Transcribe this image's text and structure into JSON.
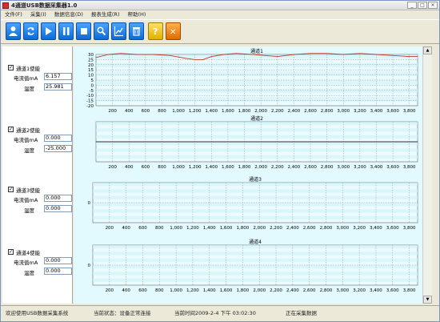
{
  "window": {
    "title": "4通道USB数据采集器1.0",
    "controls": [
      "_",
      "□",
      "×"
    ]
  },
  "menu": [
    "文件(F)",
    "采集(I)",
    "数据信息(D)",
    "报表生成(R)",
    "帮助(H)"
  ],
  "toolbar": [
    {
      "name": "user-icon",
      "color": "blue"
    },
    {
      "name": "refresh-icon",
      "color": "blue"
    },
    {
      "name": "play-icon",
      "color": "blue"
    },
    {
      "name": "pause-icon",
      "color": "blue"
    },
    {
      "name": "stop-icon",
      "color": "blue"
    },
    {
      "name": "search-icon",
      "color": "blue"
    },
    {
      "name": "chart-icon",
      "color": "blue"
    },
    {
      "name": "delete-icon",
      "color": "blue"
    },
    {
      "name": "help-icon",
      "color": "yellow",
      "glyph": "?"
    },
    {
      "name": "close-icon",
      "color": "orange",
      "glyph": "✕"
    }
  ],
  "channels": [
    {
      "enable_label": "通道1使能",
      "current_label": "电流值mA",
      "current": "6.157",
      "temp_label": "温度",
      "temp": "25.981",
      "checked": true
    },
    {
      "enable_label": "通道2使能",
      "current_label": "电流值mA",
      "current": "0.000",
      "temp_label": "温度",
      "temp": "-25.000",
      "checked": true
    },
    {
      "enable_label": "通道3使能",
      "current_label": "电流值mA",
      "current": "0.000",
      "temp_label": "温度",
      "temp": "0.000",
      "checked": true
    },
    {
      "enable_label": "通道4使能",
      "current_label": "电流值mA",
      "current": "0.000",
      "temp_label": "温度",
      "temp": "0.000",
      "checked": true
    }
  ],
  "chart_data": [
    {
      "type": "line",
      "title": "通道1",
      "xlabel": "",
      "ylabel": "",
      "xlim": [
        0,
        3900
      ],
      "ylim": [
        -20,
        30
      ],
      "yticks": [
        -20,
        -15,
        -10,
        -5,
        0,
        5,
        10,
        15,
        20,
        25,
        30
      ],
      "xticks": [
        200,
        400,
        600,
        800,
        1000,
        1200,
        1400,
        1600,
        1800,
        2000,
        2200,
        2400,
        2600,
        2800,
        3000,
        3200,
        3400,
        3600,
        3800
      ],
      "xticklabels": [
        "200",
        "400",
        "600",
        "800",
        "1,000",
        "1,200",
        "1,400",
        "1,600",
        "1,800",
        "2,000",
        "2,200",
        "2,400",
        "2,600",
        "2,800",
        "3,000",
        "3,200",
        "3,400",
        "3,600",
        "3,800"
      ],
      "grid": true,
      "series": [
        {
          "color": "#c0392b",
          "x": [
            0,
            150,
            300,
            500,
            700,
            900,
            1100,
            1200,
            1300,
            1400,
            1550,
            1700,
            1900,
            2050,
            2200,
            2400,
            2600,
            2800,
            3000,
            3200,
            3400,
            3600,
            3800,
            3900
          ],
          "y": [
            27,
            30,
            31,
            30,
            30,
            29,
            26,
            25,
            25,
            28,
            30,
            31,
            30,
            29,
            28,
            30,
            31,
            31,
            30,
            31,
            30,
            29,
            28,
            28
          ]
        }
      ]
    },
    {
      "type": "line",
      "title": "通道2",
      "xlabel": "",
      "ylabel": "",
      "xlim": [
        0,
        3900
      ],
      "ylim": [
        -1,
        1
      ],
      "yticks": [],
      "xticks": [
        200,
        400,
        600,
        800,
        1000,
        1200,
        1400,
        1600,
        1800,
        2000,
        2200,
        2400,
        2600,
        2800,
        3000,
        3200,
        3400,
        3600,
        3800
      ],
      "xticklabels": [
        "200",
        "400",
        "600",
        "800",
        "1,000",
        "1,200",
        "1,400",
        "1,600",
        "1,800",
        "2,000",
        "2,200",
        "2,400",
        "2,600",
        "2,800",
        "3,000",
        "3,200",
        "3,400",
        "3,600",
        "3,800"
      ],
      "grid": true,
      "series": [
        {
          "color": "#333333",
          "x": [
            0,
            3900
          ],
          "y": [
            0,
            0
          ]
        }
      ]
    },
    {
      "type": "line",
      "title": "通道3",
      "xlabel": "",
      "ylabel": "",
      "xlim": [
        0,
        3900
      ],
      "ylim": [
        -1,
        1
      ],
      "yticks": [
        0
      ],
      "xticks": [
        200,
        400,
        600,
        800,
        1000,
        1200,
        1400,
        1600,
        1800,
        2000,
        2200,
        2400,
        2600,
        2800,
        3000,
        3200,
        3400,
        3600,
        3800
      ],
      "xticklabels": [
        "200",
        "400",
        "600",
        "800",
        "1,000",
        "1,200",
        "1,400",
        "1,600",
        "1,800",
        "2,000",
        "2,200",
        "2,400",
        "2,600",
        "2,800",
        "3,000",
        "3,200",
        "3,400",
        "3,600",
        "3,800"
      ],
      "grid": true,
      "series": []
    },
    {
      "type": "line",
      "title": "通道4",
      "xlabel": "",
      "ylabel": "",
      "xlim": [
        0,
        3900
      ],
      "ylim": [
        -1,
        1
      ],
      "yticks": [
        0
      ],
      "xticks": [
        200,
        400,
        600,
        800,
        1000,
        1200,
        1400,
        1600,
        1800,
        2000,
        2200,
        2400,
        2600,
        2800,
        3000,
        3200,
        3400,
        3600,
        3800
      ],
      "xticklabels": [
        "200",
        "400",
        "600",
        "800",
        "1,000",
        "1,200",
        "1,400",
        "1,600",
        "1,800",
        "2,000",
        "2,200",
        "2,400",
        "2,600",
        "2,800",
        "3,000",
        "3,200",
        "3,400",
        "3,600",
        "3,800"
      ],
      "grid": true,
      "series": []
    }
  ],
  "status": {
    "welcome": "欢迎使用USB数据采集系统",
    "state": "当前状态：设备正常连接",
    "time": "当前时间2009-2-4 下午 03:02:30",
    "action": "正在采集数据"
  },
  "colors": {
    "chart_bg": "#ecfbfd",
    "grid": "#9a9a9a",
    "band": "#cdf3f9",
    "accent": "#0a6ad6"
  }
}
